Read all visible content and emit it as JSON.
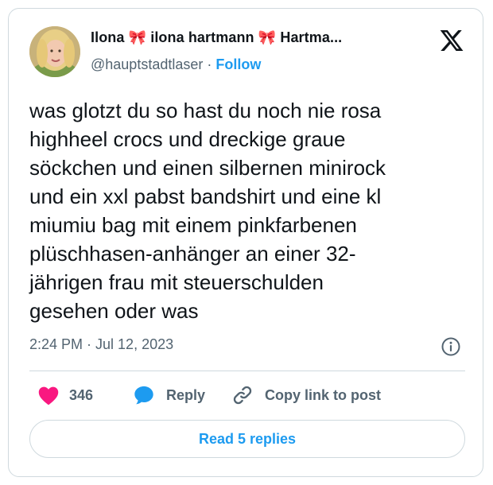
{
  "tweet": {
    "display_name": "Ilona 🎀 ilona hartmann 🎀 Hartma...",
    "handle": "@hauptstadtlaser",
    "separator": "·",
    "follow_label": "Follow",
    "text_lines": [
      "was glotzt du so hast du noch nie rosa",
      "highheel crocs und dreckige graue",
      "söckchen und einen silbernen minirock",
      "und ein xxl pabst bandshirt und eine kl",
      "miumiu bag mit einem pinkfarbenen",
      "plüschhasen-anhänger an einer 32-",
      "jährigen frau mit steuerschulden",
      "gesehen oder was"
    ],
    "timestamp": "2:24 PM · Jul 12, 2023"
  },
  "actions": {
    "like_count": "346",
    "reply_label": "Reply",
    "copy_link_label": "Copy link to post"
  },
  "footer": {
    "read_replies_label": "Read 5 replies"
  },
  "colors": {
    "accent": "#1d9bf0",
    "like": "#f91880",
    "muted": "#536471",
    "text": "#0f1419",
    "border": "#cfd9de"
  },
  "icons": {
    "logo": "x-logo-icon",
    "info": "info-icon",
    "like": "heart-icon",
    "reply": "speech-bubble-icon",
    "copy": "link-icon"
  }
}
